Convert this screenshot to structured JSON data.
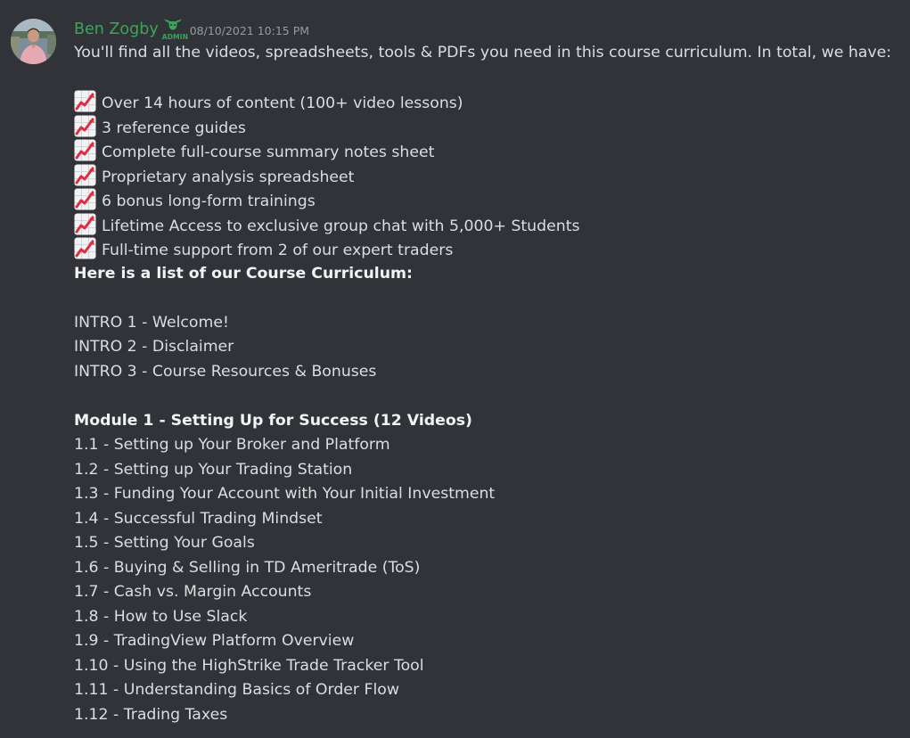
{
  "message": {
    "author": "Ben Zogby",
    "role_badge": "ADMIN",
    "timestamp": "08/10/2021 10:15 PM",
    "intro": "You'll find all the videos, spreadsheets, tools & PDFs you need in this course curriculum. In total, we have:",
    "bullet_icon": "chart-increasing-emoji",
    "bullets": [
      "Over 14 hours of content (100+ video lessons)",
      "3 reference guides",
      "Complete full-course summary notes sheet",
      "Proprietary analysis spreadsheet",
      "6 bonus long-form trainings",
      "Lifetime Access to exclusive group chat with 5,000+ Students",
      "Full-time support from 2 of our expert traders"
    ],
    "curriculum_heading": "Here is a list of our Course Curriculum:",
    "intro_items": [
      "INTRO 1 - Welcome!",
      "INTRO 2 - Disclaimer",
      "INTRO 3 - Course Resources & Bonuses"
    ],
    "module_heading": "Module 1 - Setting Up for Success (12 Videos)",
    "module_items": [
      "1.1 - Setting up Your Broker and Platform",
      "1.2 - Setting up Your Trading Station",
      "1.3 - Funding Your Account with Your Initial Investment",
      "1.4 - Successful Trading Mindset",
      "1.5 - Setting Your Goals",
      "1.6 - Buying & Selling in TD Ameritrade (ToS)",
      "1.7 - Cash vs. Margin Accounts",
      "1.8 - How to Use Slack",
      "1.9 - TradingView Platform Overview",
      "1.10 - Using the HighStrike Trade Tracker Tool",
      "1.11 - Understanding Basics of Order Flow",
      "1.12 - Trading Taxes"
    ]
  },
  "colors": {
    "background": "#313338",
    "username": "#3ba55c",
    "text": "#dbdee1",
    "timestamp": "#949ba4"
  }
}
